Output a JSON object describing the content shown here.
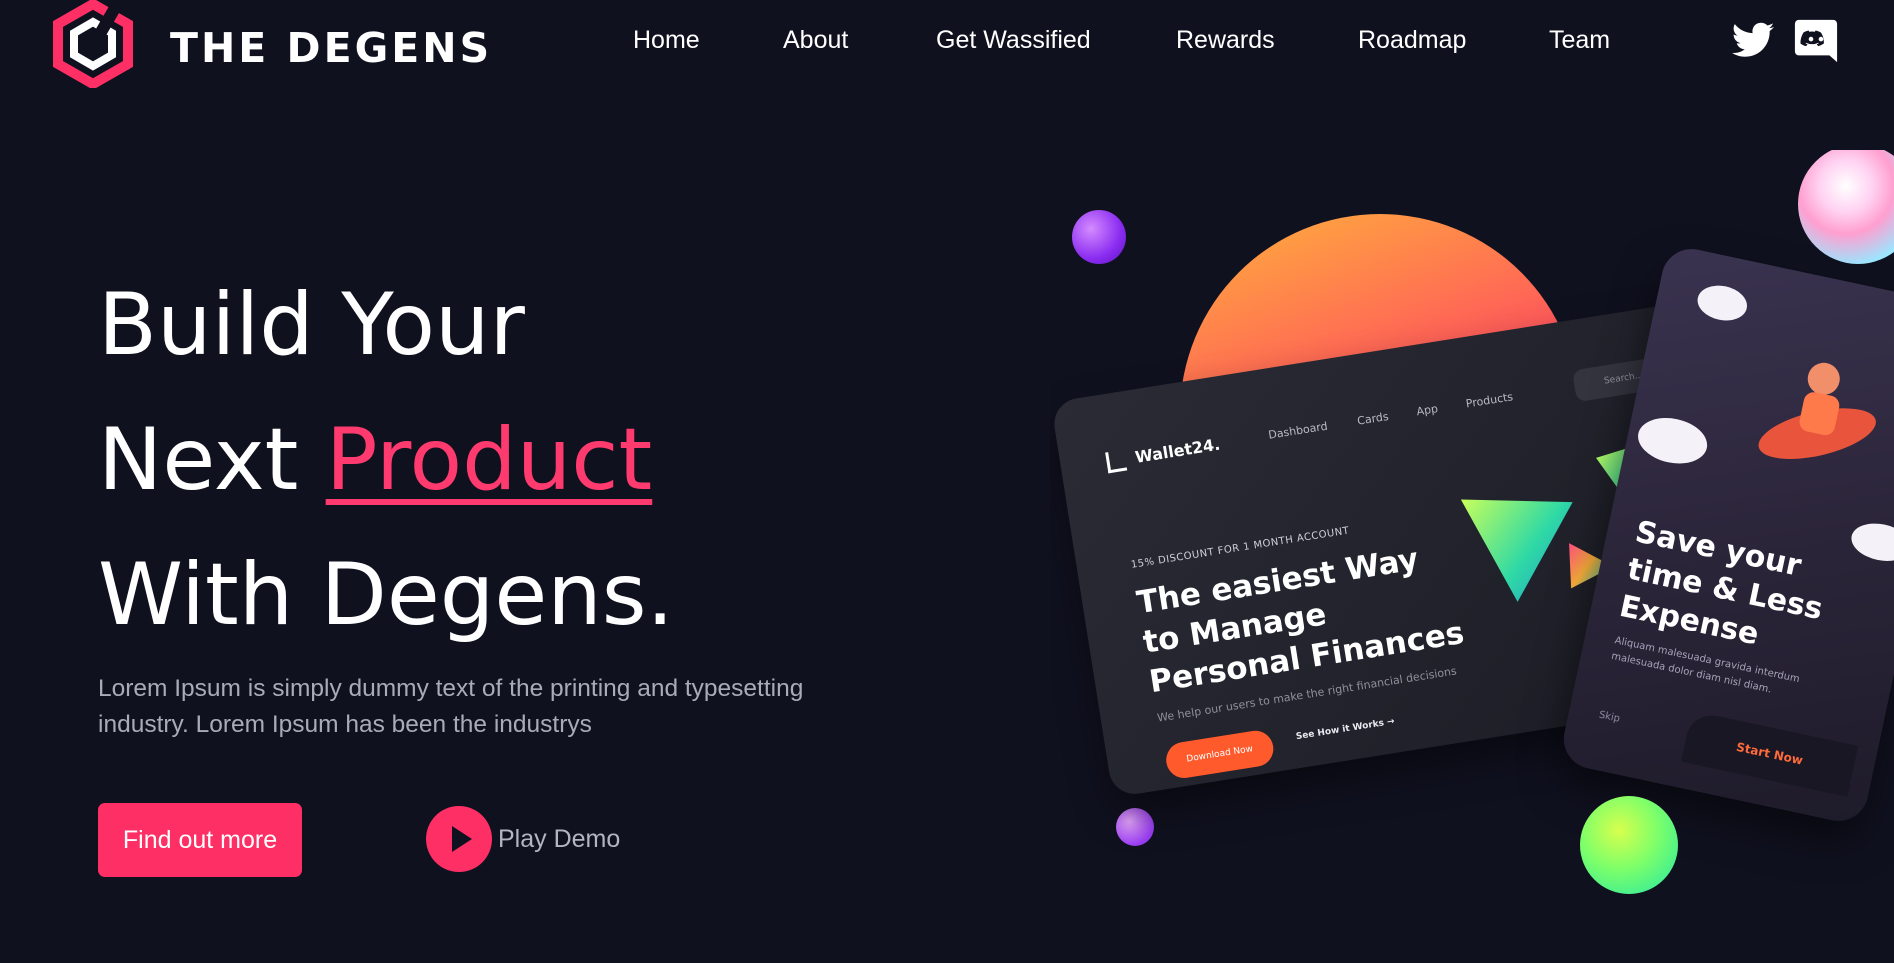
{
  "brand": {
    "name": "THE DEGENS"
  },
  "nav": {
    "items": [
      "Home",
      "About",
      "Get Wassified",
      "Rewards",
      "Roadmap",
      "Team"
    ]
  },
  "social": {
    "icons": [
      "twitter-icon",
      "discord-icon"
    ]
  },
  "hero": {
    "line1": "Build Your",
    "line2_prefix": "Next ",
    "line2_accent": "Product",
    "line3": "With Degens.",
    "description": "Lorem Ipsum is simply dummy text of the printing and typesetting industry. Lorem Ipsum has been the industrys",
    "cta_label": "Find out more",
    "play_label": "Play Demo"
  },
  "mockup": {
    "logo": "Wallet24.",
    "nav": [
      "Dashboard",
      "Cards",
      "App",
      "Products"
    ],
    "search_placeholder": "Search...",
    "badge": "15% DISCOUNT FOR 1 MONTH ACCOUNT",
    "title": "The easiest Way to Manage Personal Finances",
    "subtitle": "We help our users to make the right financial decisions",
    "download_label": "Download Now",
    "how_label": "See How it Works →"
  },
  "phone": {
    "title": "Save your time & Less Expense",
    "subtitle": "Aliquam malesuada gravida interdum malesuada dolor diam nisl diam.",
    "skip_label": "Skip",
    "start_label": "Start Now"
  },
  "colors": {
    "background": "#10111f",
    "accent": "#fe2f64",
    "muted_text": "#a9abb8"
  }
}
